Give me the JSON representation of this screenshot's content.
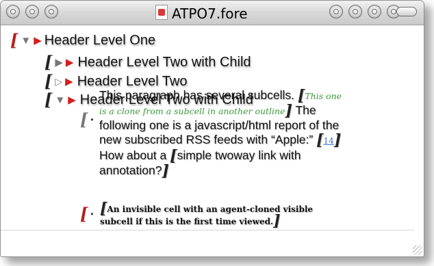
{
  "window": {
    "title": "ATPO7.fore"
  },
  "outline": {
    "h1": "Header Level One",
    "h2a": "Header Level Two with Child",
    "h2b": "Header Level Two",
    "h2c": "Header Level Two with Child",
    "para1": "This paragraph has several subcells.",
    "clone": "This one is a clone from a subcell in another outline",
    "para2": "The following one is a javascript/html report of the new subscribed RSS feeds with “Apple:”",
    "link_number": "14",
    "para3": "How about a",
    "twoway": "simple twoway link with annotation?",
    "invisible": "An invisible cell with an agent-cloned visible subcell if this is the first time viewed."
  },
  "colors": {
    "bracket_red": "#b81d1d",
    "triangle_red": "#d41d1d",
    "clone_green": "#3c9a3c",
    "link_blue": "#3a6fd8"
  }
}
